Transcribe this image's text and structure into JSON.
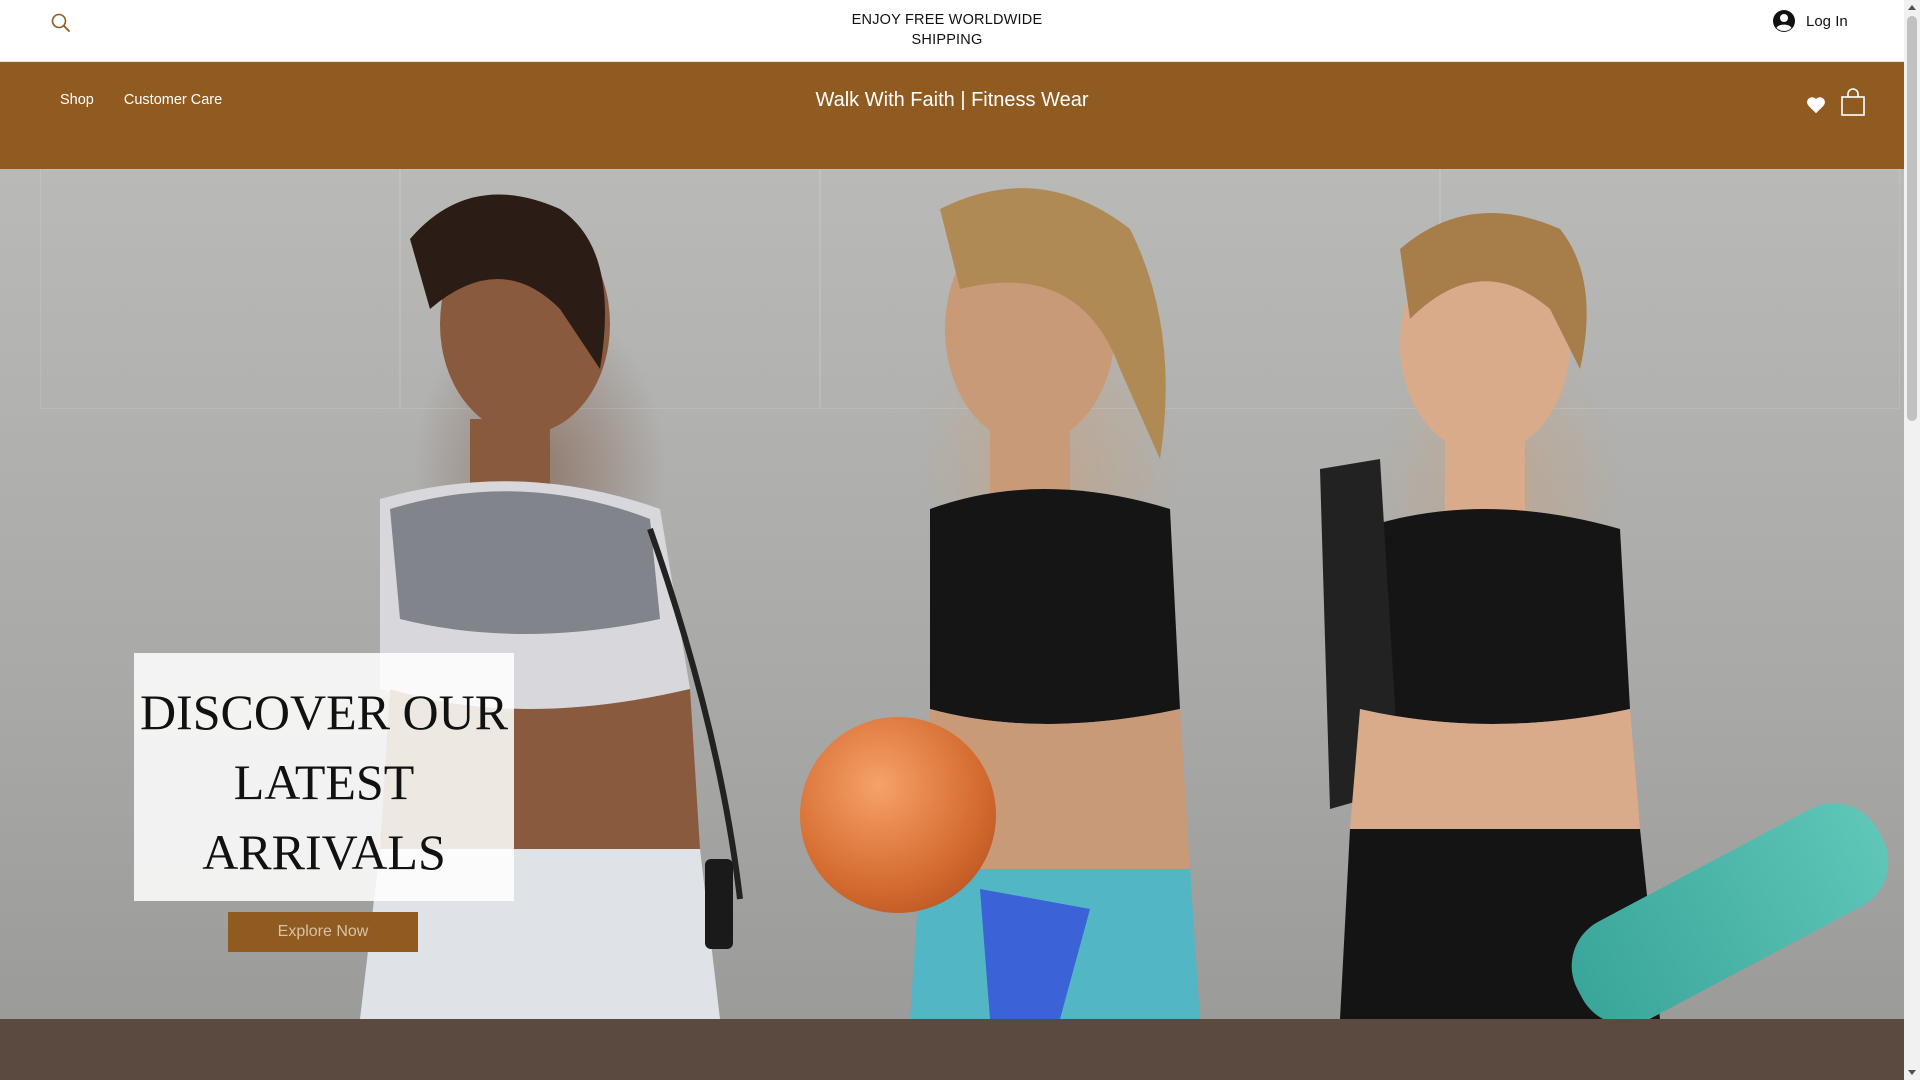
{
  "topbar": {
    "search_icon": "search-icon",
    "announcement": "ENJOY FREE WORLDWIDE SHIPPING",
    "login_label": "Log In",
    "login_icon": "user-avatar-icon"
  },
  "header": {
    "nav": [
      {
        "label": "Shop"
      },
      {
        "label": "Customer Care"
      }
    ],
    "brand": "Walk With Faith | Fitness Wear",
    "wishlist_icon": "heart-icon",
    "cart_icon": "shopping-bag-icon",
    "background_color": "#8f5b20"
  },
  "hero": {
    "title": "DISCOVER OUR LATEST ARRIVALS",
    "cta_label": "Explore Now",
    "cta_color": "#8f5b20"
  }
}
